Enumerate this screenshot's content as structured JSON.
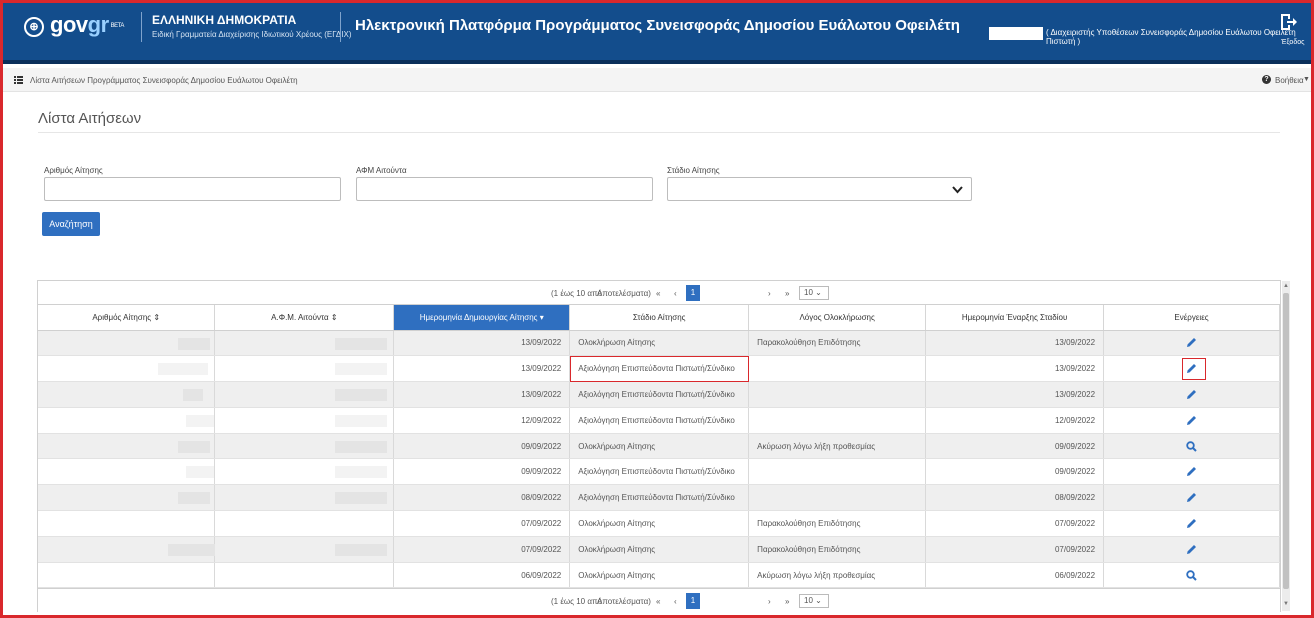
{
  "header": {
    "logo_gov": "gov",
    "logo_gr": "gr",
    "logo_beta": "BETA",
    "org_name": "ΕΛΛΗΝΙΚΗ ΔΗΜΟΚΡΑΤΙΑ",
    "org_sub": "Ειδική Γραμματεία Διαχείρισης Ιδιωτικού Χρέους (ΕΓΔΙΧ)",
    "platform_title": "Ηλεκτρονική Πλατφόρμα Προγράμματος Συνεισφοράς Δημοσίου Ευάλωτου Οφειλέτη",
    "user_role": "( Διαχειριστής Υποθέσεων Συνεισφοράς Δημοσίου Ευάλωτου Οφειλέτη Πιστωτή )",
    "exit_label": "Έξοδος"
  },
  "breadcrumb": {
    "text": "Λίστα Αιτήσεων Προγράμματος Συνεισφοράς Δημοσίου Ευάλωτου Οφειλέτη",
    "help_label": "Βοήθεια"
  },
  "page": {
    "title": "Λίστα Αιτήσεων"
  },
  "filters": {
    "application_number_label": "Αριθμός Αίτησης",
    "afm_label": "ΑΦΜ Αιτούντα",
    "stage_label": "Στάδιο Αίτησης",
    "search_button": "Αναζήτηση"
  },
  "pager": {
    "summary": "(1 έως 10 από",
    "results": "Αποτελέσματα)",
    "first": "«",
    "prev": "‹",
    "current_page": "1",
    "next": "›",
    "last": "»",
    "page_size": "10"
  },
  "table": {
    "columns": [
      "Αριθμός Αίτησης",
      "Α.Φ.Μ. Αιτούντα",
      "Ημερομηνία Δημιουργίας Αίτησης",
      "Στάδιο Αίτησης",
      "Λόγος Ολοκλήρωσης",
      "Ημερομηνία Έναρξης Σταδίου",
      "Ενέργειες"
    ],
    "rows": [
      {
        "created": "13/09/2022",
        "stage": "Ολοκλήρωση Αίτησης",
        "reason": "Παρακολούθηση Επιδότησης",
        "stage_start": "13/09/2022",
        "action": "edit-icon"
      },
      {
        "created": "13/09/2022",
        "stage": "Αξιολόγηση Επισπεύδοντα Πιστωτή/Σύνδικο",
        "reason": "",
        "stage_start": "13/09/2022",
        "action": "edit-icon"
      },
      {
        "created": "13/09/2022",
        "stage": "Αξιολόγηση Επισπεύδοντα Πιστωτή/Σύνδικο",
        "reason": "",
        "stage_start": "13/09/2022",
        "action": "edit-icon"
      },
      {
        "created": "12/09/2022",
        "stage": "Αξιολόγηση Επισπεύδοντα Πιστωτή/Σύνδικο",
        "reason": "",
        "stage_start": "12/09/2022",
        "action": "edit-icon"
      },
      {
        "created": "09/09/2022",
        "stage": "Ολοκλήρωση Αίτησης",
        "reason": "Ακύρωση λόγω λήξη προθεσμίας",
        "stage_start": "09/09/2022",
        "action": "search-icon"
      },
      {
        "created": "09/09/2022",
        "stage": "Αξιολόγηση Επισπεύδοντα Πιστωτή/Σύνδικο",
        "reason": "",
        "stage_start": "09/09/2022",
        "action": "edit-icon"
      },
      {
        "created": "08/09/2022",
        "stage": "Αξιολόγηση Επισπεύδοντα Πιστωτή/Σύνδικο",
        "reason": "",
        "stage_start": "08/09/2022",
        "action": "edit-icon"
      },
      {
        "created": "07/09/2022",
        "stage": "Ολοκλήρωση Αίτησης",
        "reason": "Παρακολούθηση Επιδότησης",
        "stage_start": "07/09/2022",
        "action": "edit-icon"
      },
      {
        "created": "07/09/2022",
        "stage": "Ολοκλήρωση Αίτησης",
        "reason": "Παρακολούθηση Επιδότησης",
        "stage_start": "07/09/2022",
        "action": "edit-icon"
      },
      {
        "created": "06/09/2022",
        "stage": "Ολοκλήρωση Αίτησης",
        "reason": "Ακύρωση λόγω λήξη προθεσμίας",
        "stage_start": "06/09/2022",
        "action": "search-icon"
      }
    ]
  },
  "colors": {
    "header_bg": "#134d8c",
    "accent": "#2f6fc0",
    "highlight": "#d9282c"
  }
}
